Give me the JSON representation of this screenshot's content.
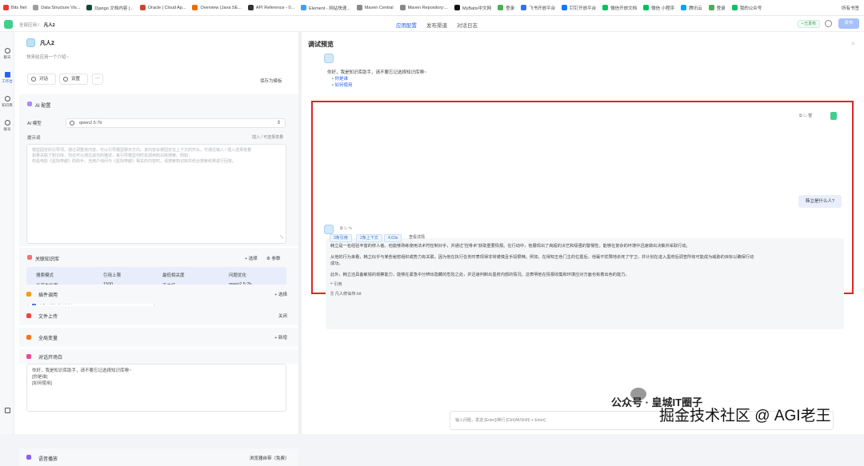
{
  "bookmarks": [
    "Bits Net",
    "Data Structure Vis...",
    "Django 文档内容 |...",
    "Oracle | Cloud Ap...",
    "Overview (Java SE...",
    "API Reference - 0...",
    "Element - 网站快速...",
    "Maven Central",
    "Maven Repository:...",
    "MyBatis中文网",
    "登录",
    "飞书开放平台",
    "钉钉开放平台",
    "微信开放文档",
    "微信 小程序",
    "腾讯云",
    "登录",
    "我的公众号"
  ],
  "bookmarks_right": "所有书签",
  "topbar": {
    "crumb_root": "全部应用",
    "crumb_app": "凡人2",
    "tabs": [
      "应用配置",
      "发布渠道",
      "对话日志"
    ],
    "status": "• 已发布",
    "publish": "发布"
  },
  "nav": [
    "聊天",
    "工作台",
    "知识库",
    "账号"
  ],
  "app": {
    "name": "凡人2",
    "desc": "快来给应用一个介绍~",
    "btn_chat": "对话",
    "btn_settings": "设置",
    "more": "···",
    "save_template": "保存为模板"
  },
  "ai": {
    "title": "AI 配置",
    "model_label": "AI 模型",
    "model_value": "qwen2.5:7b",
    "prompt_label": "提示词",
    "insert_var": "插入 / 可选择变量",
    "prompt_placeholder": "模型固定的引导词，通过调整该内容，可以引导模型聊天方向。该内容会被固定在上下文的开头。可通过输入 / 插入选择变量\n如果关联了知识库，你还可以通过适当的描述，来引导模型何时去调用知识库搜索。例如：\n你是电影《星际穿越》的助手，当用户询问与《星际穿越》相关的内容时，请搜索知识库并结合搜索结果进行回答。"
  },
  "kb": {
    "title": "关联知识库",
    "select": "选择",
    "params": "参数",
    "headers": [
      "搜索模式",
      "引用上限",
      "最低相关度",
      "问题优化"
    ],
    "values": [
      "长高生检索",
      "1500",
      "不支持",
      "qwen2.5:7b"
    ],
    "item": "凡人测试知识库"
  },
  "rows": {
    "tools": "插件调用",
    "tools_action": "选择",
    "upload": "文件上传",
    "upload_action": "关闭",
    "vars": "全局变量",
    "vars_action": "新增",
    "opener": "对话开场白"
  },
  "opener_text": "你好，我是知识库助手，请不要忘记选择知识库噢~\n[你是谁]\n[如何使用]",
  "voice": {
    "label": "语音播放",
    "value": "浏览器自带（免费）"
  },
  "preview": {
    "title": "调试预览",
    "greeting": "你好，我是知识库助手，请不要忘记选择知识库噢~",
    "quick1": "你是谁",
    "quick2": "如何使用"
  },
  "chat": {
    "user_msg": "韩立是什么人?",
    "p1": "韩立是一名经验丰富的修人者。他能够熟练使用法术符控制对手，并通过“控骨术”获取重要情报。在行动中，他展现出了高超的决艺和极强的警惕性，能够在复杂的环境中迅速做出决策并采取行动。",
    "p2": "从他的行为来看，韩立似乎与某些秘密组织或势力有关联，因为他在执行任务时表现得非常谨慎且手段狠辣。例如，在得知五色门主的位置后，他毫不犹豫地杀死了守卫，并计划在进入墨府后调查所有可能成为威胁的目标以确保行动成功。",
    "p3": "此外，韩立还具备敏锐的观察能力，能够在紧急中分辨出隐藏的危险之处，并迅速判断出墨府内部的情况，这表明他在情报收集和环境应对方面也有着出色的能力。",
    "quote_label": "引用",
    "quote_file": "凡人修仙传.txt",
    "badges": [
      "3条引用",
      "2条上下文",
      "4.63s"
    ],
    "details": "查看详情"
  },
  "input_placeholder": "输入问题，发送 [Enter]/换行 [Ctrl(Alt/Shift) + Enter]",
  "watermark": {
    "line1": "公众号 · 皇城IT圈子",
    "line2": "掘金技术社区 @ AGI老王"
  }
}
